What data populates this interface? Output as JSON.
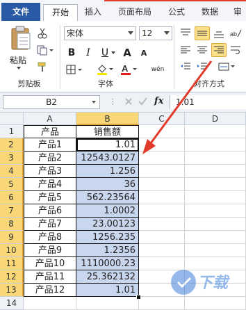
{
  "tabs": {
    "file": "文件",
    "home": "开始",
    "insert": "插入",
    "page_layout": "页面布局",
    "formulas": "公式",
    "data": "数据",
    "review": "审"
  },
  "clipboard": {
    "paste_label": "粘贴",
    "group_label": "剪贴板"
  },
  "font": {
    "name": "宋体",
    "size": "12",
    "bold": "B",
    "italic": "I",
    "underline": "U",
    "grow": "A",
    "shrink": "A",
    "phonetic": "wén",
    "group_label": "字体"
  },
  "alignment": {
    "group_label": "对齐方式"
  },
  "formula_bar": {
    "name_box": "B2",
    "fx": "fx",
    "value": "1.01"
  },
  "grid": {
    "columns": [
      "A",
      "B",
      "C",
      "D"
    ],
    "rows": [
      {
        "n": "1",
        "a": "产品",
        "b": "销售额"
      },
      {
        "n": "2",
        "a": "产品1",
        "b": "1.01"
      },
      {
        "n": "3",
        "a": "产品2",
        "b": "12543.0127"
      },
      {
        "n": "4",
        "a": "产品3",
        "b": "1.256"
      },
      {
        "n": "5",
        "a": "产品4",
        "b": "36"
      },
      {
        "n": "6",
        "a": "产品5",
        "b": "562.23564"
      },
      {
        "n": "7",
        "a": "产品6",
        "b": "1.0002"
      },
      {
        "n": "8",
        "a": "产品7",
        "b": "23.00123"
      },
      {
        "n": "9",
        "a": "产品8",
        "b": "1256.235"
      },
      {
        "n": "10",
        "a": "产品9",
        "b": "1.2356"
      },
      {
        "n": "11",
        "a": "产品10",
        "b": "1110000.23"
      },
      {
        "n": "12",
        "a": "产品11",
        "b": "25.362132"
      },
      {
        "n": "13",
        "a": "产品12",
        "b": "1.01"
      },
      {
        "n": "14",
        "a": "",
        "b": ""
      }
    ]
  },
  "colors": {
    "file_tab": "#2a5aa6",
    "selection_fill": "#c9d7ee",
    "header_selected": "#f9d776",
    "annotation_arrow": "#e23b2c"
  },
  "watermark": "下载"
}
